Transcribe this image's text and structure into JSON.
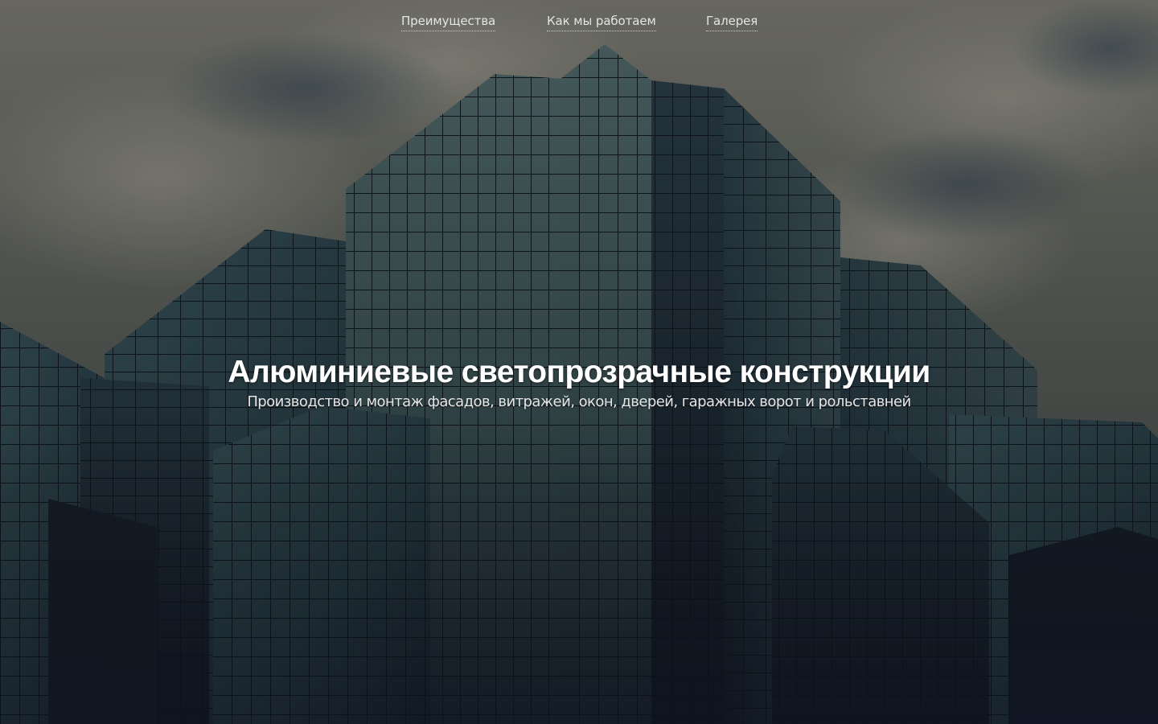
{
  "nav": {
    "items": [
      {
        "label": "Преимущества"
      },
      {
        "label": "Как мы работаем"
      },
      {
        "label": "Галерея"
      }
    ]
  },
  "hero": {
    "title": "Алюминиевые светопрозрачные конструкции",
    "subtitle": "Производство и монтаж фасадов, витражей, окон, дверей, гаражных ворот и рольставней"
  }
}
